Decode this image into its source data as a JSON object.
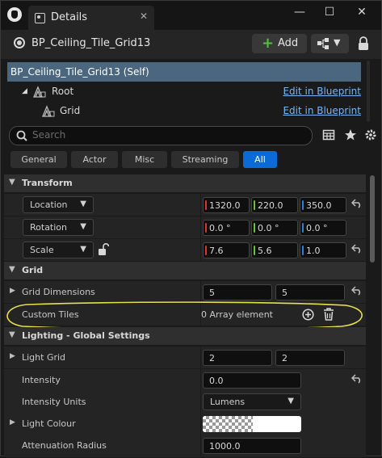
{
  "window": {
    "tab_title": "Details",
    "tab_close": "✕",
    "minimize": "—",
    "maximize": "☐",
    "close": "✕"
  },
  "header": {
    "actor_name": "BP_Ceiling_Tile_Grid13",
    "add_label": "Add",
    "add_plus": "+"
  },
  "tree": {
    "self_label": "BP_Ceiling_Tile_Grid13 (Self)",
    "items": [
      {
        "label": "Root",
        "link": "Edit in Blueprint"
      },
      {
        "label": "Grid",
        "link": "Edit in Blueprint"
      }
    ]
  },
  "search": {
    "placeholder": "Search"
  },
  "filters": [
    "General",
    "Actor",
    "Misc",
    "Streaming",
    "All"
  ],
  "active_filter": "All",
  "transform": {
    "title": "Transform",
    "location": {
      "label": "Location",
      "x": "1320.0",
      "y": "220.0",
      "z": "350.0"
    },
    "rotation": {
      "label": "Rotation",
      "x": "0.0 °",
      "y": "0.0 °",
      "z": "0.0 °"
    },
    "scale": {
      "label": "Scale",
      "x": "7.6",
      "y": "5.6",
      "z": "1.0"
    }
  },
  "grid": {
    "title": "Grid",
    "dimensions": {
      "label": "Grid Dimensions",
      "x": "5",
      "y": "5"
    },
    "custom_tiles": {
      "label": "Custom Tiles",
      "value": "0 Array element"
    }
  },
  "lighting": {
    "title": "Lighting - Global Settings",
    "light_grid": {
      "label": "Light Grid",
      "x": "2",
      "y": "2"
    },
    "intensity": {
      "label": "Intensity",
      "value": "0.0"
    },
    "intensity_units": {
      "label": "Intensity Units",
      "value": "Lumens"
    },
    "light_colour": {
      "label": "Light Colour"
    },
    "attenuation_radius": {
      "label": "Attenuation Radius",
      "value": "1000.0"
    }
  },
  "colors": {
    "accent": "#0a6ad6",
    "selection": "#4b6780",
    "link": "#78b6f4",
    "axis_x": "#d63a2f",
    "axis_y": "#6fbf3a",
    "axis_z": "#2f7fd6",
    "annotation": "#e8e04a",
    "add_plus": "#4fc13d"
  },
  "icons": {
    "app": "unreal-logo-icon",
    "tab": "details-icon",
    "actor": "blueprint-actor-icon",
    "toolbar": [
      "blueprint-options-icon",
      "lock-icon"
    ],
    "search": "search-icon",
    "tools": [
      "table-view-icon",
      "favorites-star-icon",
      "settings-gear-icon"
    ]
  }
}
